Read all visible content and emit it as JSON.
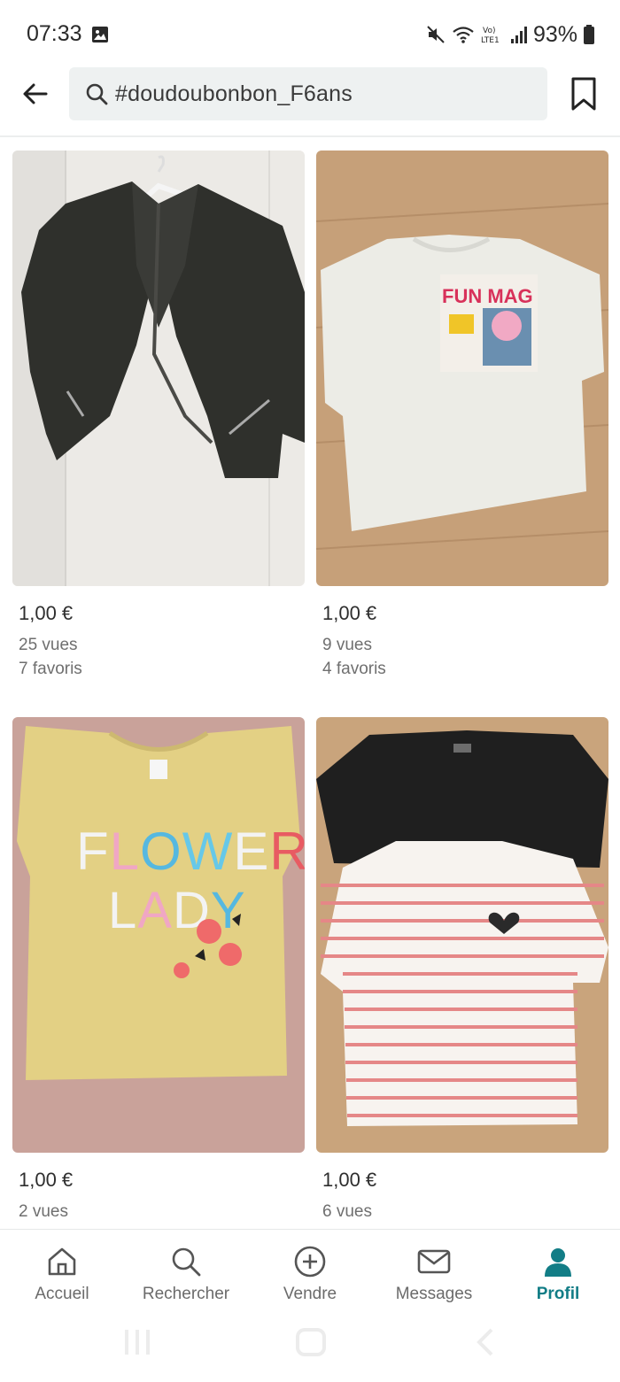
{
  "status_bar": {
    "time": "07:33",
    "battery": "93%",
    "icons": [
      "gallery-icon",
      "mute-icon",
      "wifi-icon",
      "volte-icon",
      "signal-icon",
      "battery-icon"
    ]
  },
  "header": {
    "search_query": "#doudoubonbon_F6ans"
  },
  "products": [
    {
      "price": "1,00 €",
      "views": "25 vues",
      "favorites": "7 favoris"
    },
    {
      "price": "1,00 €",
      "views": "9 vues",
      "favorites": "4 favoris",
      "print_text": "FUN MAG"
    },
    {
      "price": "1,00 €",
      "views": "2 vues",
      "favorites": "",
      "print_text_1": "FLOWER",
      "print_text_2": "LADY"
    },
    {
      "price": "1,00 €",
      "views": "6 vues",
      "favorites": ""
    }
  ],
  "bottom_nav": {
    "items": [
      {
        "label": "Accueil",
        "icon": "home-icon"
      },
      {
        "label": "Rechercher",
        "icon": "search-icon"
      },
      {
        "label": "Vendre",
        "icon": "plus-circle-icon"
      },
      {
        "label": "Messages",
        "icon": "envelope-icon"
      },
      {
        "label": "Profil",
        "icon": "profile-icon",
        "active": true
      }
    ]
  },
  "colors": {
    "accent": "#127d86",
    "search_bg": "#eef1f1",
    "text_secondary": "#6f6f6f"
  }
}
